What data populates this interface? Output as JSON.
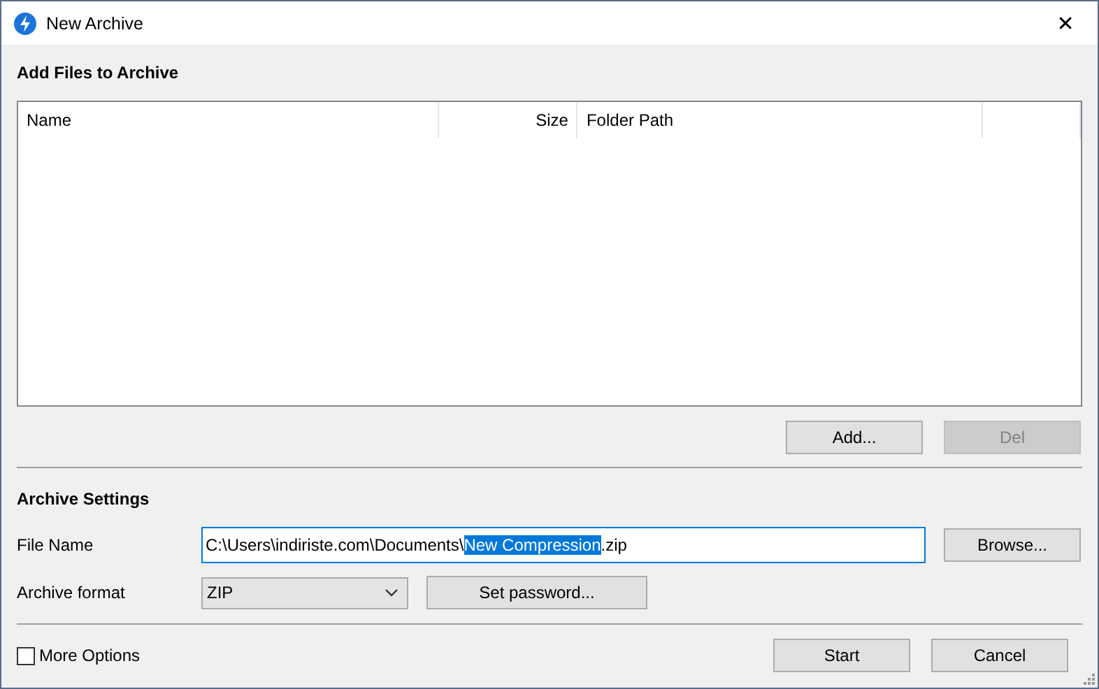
{
  "window": {
    "title": "New Archive",
    "close": "✕"
  },
  "files_section": {
    "heading": "Add Files to Archive"
  },
  "table": {
    "columns": [
      {
        "label": "Name",
        "right_aligned": false
      },
      {
        "label": "Size",
        "right_aligned": true
      },
      {
        "label": "Folder Path",
        "right_aligned": false
      }
    ]
  },
  "list_buttons": [
    {
      "label": "Add...",
      "disabled": false
    },
    {
      "label": "Del",
      "disabled": true
    }
  ],
  "settings": {
    "heading": "Archive Settings",
    "file_name": {
      "label": "File Name",
      "value_parts": [
        {
          "text": "C:\\Users\\indiriste.com\\Documents\\",
          "selected": false
        },
        {
          "text": "New Compression",
          "selected": true
        },
        {
          "text": ".zip",
          "selected": false
        }
      ],
      "button": "Browse..."
    },
    "format": {
      "label": "Archive format",
      "value": "ZIP",
      "button": "Set password..."
    }
  },
  "more_options": {
    "label": "More Options",
    "checked": false
  },
  "footer_buttons": [
    {
      "label": "Start"
    },
    {
      "label": "Cancel"
    }
  ]
}
